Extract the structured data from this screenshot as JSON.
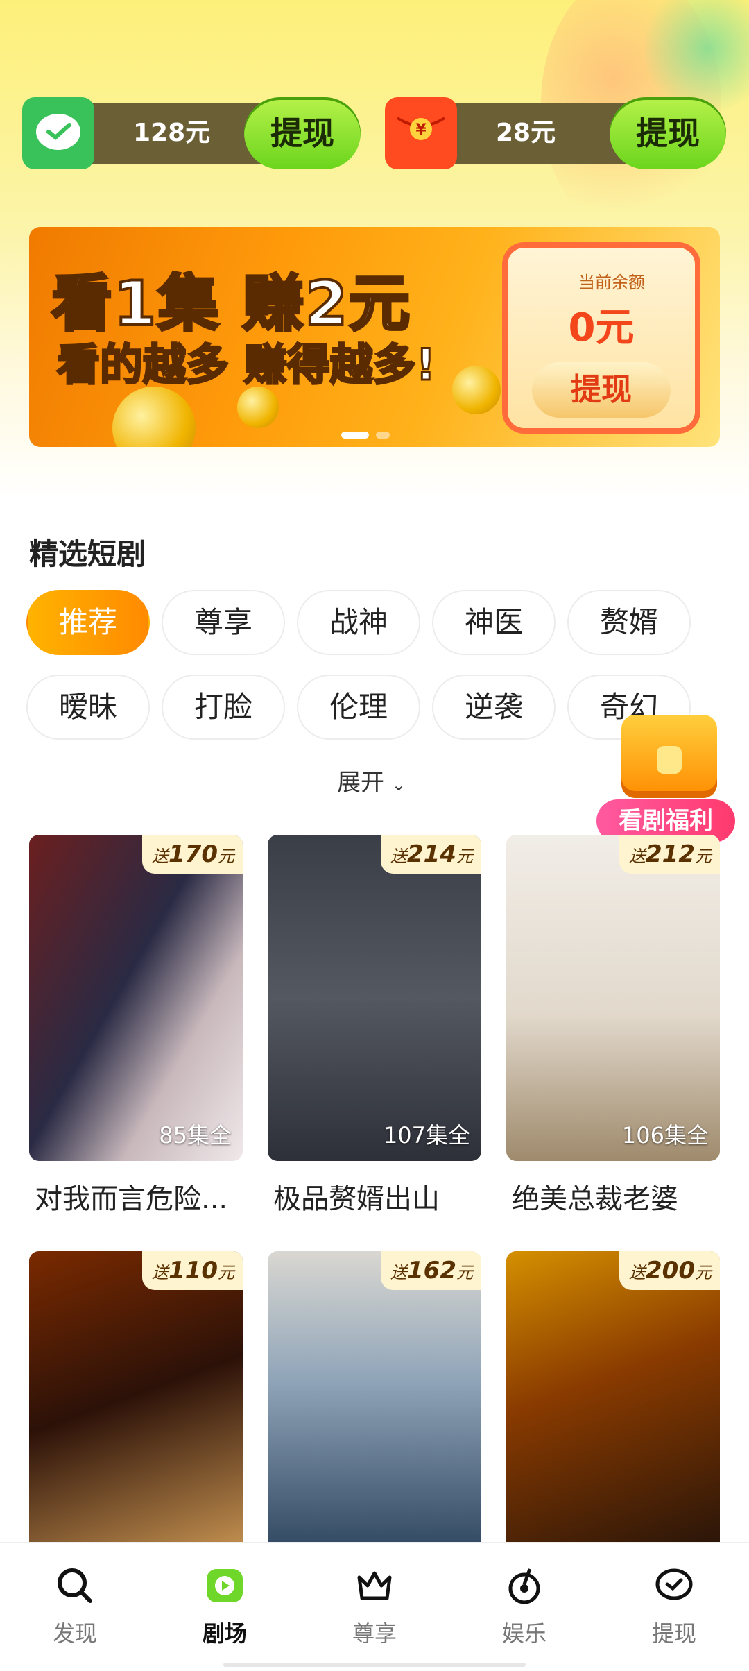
{
  "wallet": {
    "wechat": {
      "amount": "128元",
      "button": "提现"
    },
    "redpacket": {
      "amount": "28元",
      "button": "提现",
      "icon_text": "¥"
    }
  },
  "banner": {
    "line1": "看1集 赚2元",
    "line2": "看的越多 赚得越多!",
    "balance_label": "当前余额",
    "balance_value": "0元",
    "withdraw": "提现"
  },
  "section": {
    "title": "精选短剧",
    "chips": [
      "推荐",
      "尊享",
      "战神",
      "神医",
      "赘婿",
      "暧昧",
      "打脸",
      "伦理",
      "逆袭",
      "奇幻"
    ],
    "active_chip": "推荐",
    "expand": "展开"
  },
  "treasure": {
    "label": "看剧福利"
  },
  "dramas": [
    {
      "title": "对我而言危险...",
      "reward_prefix": "送",
      "reward": "170",
      "reward_suffix": "元",
      "episodes": "85集全"
    },
    {
      "title": "极品赘婿出山",
      "reward_prefix": "送",
      "reward": "214",
      "reward_suffix": "元",
      "episodes": "107集全"
    },
    {
      "title": "绝美总裁老婆",
      "reward_prefix": "送",
      "reward": "212",
      "reward_suffix": "元",
      "episodes": "106集全"
    },
    {
      "title": "",
      "reward_prefix": "送",
      "reward": "110",
      "reward_suffix": "元",
      "episodes": ""
    },
    {
      "title": "",
      "reward_prefix": "送",
      "reward": "162",
      "reward_suffix": "元",
      "episodes": ""
    },
    {
      "title": "",
      "reward_prefix": "送",
      "reward": "200",
      "reward_suffix": "元",
      "episodes": ""
    }
  ],
  "nav": [
    {
      "label": "发现",
      "icon": "search-icon"
    },
    {
      "label": "剧场",
      "icon": "play-icon"
    },
    {
      "label": "尊享",
      "icon": "crown-icon"
    },
    {
      "label": "娱乐",
      "icon": "music-icon"
    },
    {
      "label": "提现",
      "icon": "chat-check-icon"
    }
  ],
  "nav_active": "剧场"
}
